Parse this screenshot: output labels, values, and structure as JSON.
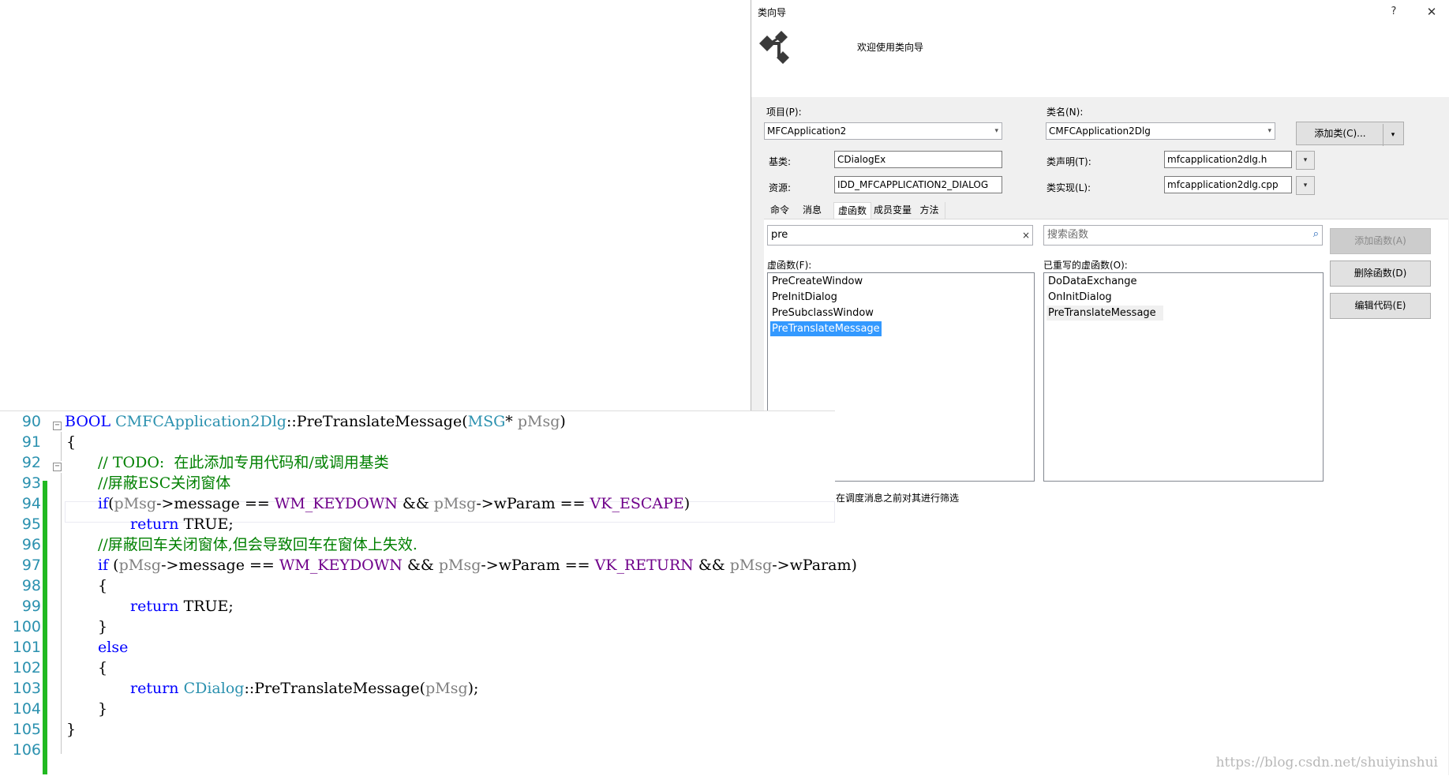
{
  "dialog": {
    "title": "类向导",
    "help": "?",
    "close": "✕",
    "welcome": "欢迎使用类向导",
    "project_label": "项目(P):",
    "project_value": "MFCApplication2",
    "class_label": "类名(N):",
    "class_value": "CMFCApplication2Dlg",
    "add_class_label": "添加类(C)...",
    "add_class_arrow": "▾",
    "base_label": "基类:",
    "base_value": "CDialogEx",
    "resource_label": "资源:",
    "resource_value": "IDD_MFCAPPLICATION2_DIALOG",
    "decl_label": "类声明(T):",
    "decl_value": "mfcapplication2dlg.h",
    "impl_label": "类实现(L):",
    "impl_value": "mfcapplication2dlg.cpp",
    "dropdown_glyph": "▾",
    "tabs": [
      "命令",
      "消息",
      "虚函数",
      "成员变量",
      "方法"
    ],
    "active_tab": "虚函数",
    "filter_value": "pre",
    "filter_clear": "×",
    "search_placeholder": "搜索函数",
    "add_function": "添加函数(A)",
    "delete_function": "删除函数(D)",
    "edit_code": "编辑代码(E)",
    "virtuals_label": "虚函数(F):",
    "virtuals": [
      "PreCreateWindow",
      "PreInitDialog",
      "PreSubclassWindow",
      "PreTranslateMessage"
    ],
    "selected_virtual": "PreTranslateMessage",
    "overridden_label": "已重写的虚函数(O):",
    "overridden": [
      "DoDataExchange",
      "OnInitDialog",
      "PreTranslateMessage"
    ],
    "description": "在调度消息之前对其进行筛选"
  },
  "editor": {
    "line_numbers": [
      "90",
      "91",
      "92",
      "93",
      "94",
      "95",
      "96",
      "97",
      "98",
      "99",
      "100",
      "101",
      "102",
      "103",
      "104",
      "105",
      "106"
    ],
    "lines": {
      "l90": {
        "bool": "BOOL",
        "cls": "CMFCApplication2Dlg",
        "scope": "::",
        "fn": "PreTranslateMessage",
        "open": "(",
        "type": "MSG",
        "star": "* ",
        "param": "pMsg",
        "close": ")"
      },
      "l91": {
        "text": "{"
      },
      "l92": {
        "text": "// TODO:  在此添加专用代码和/或调用基类"
      },
      "l93": {
        "text": "//屏蔽ESC关闭窗体"
      },
      "l94": {
        "kw": "if",
        "p1": "(",
        "v1": "pMsg",
        "a1": "->",
        "m1": "message == ",
        "c1": "WM_KEYDOWN",
        "t1": " && ",
        "v2": "pMsg",
        "a2": "->",
        "m2": "wParam == ",
        "c2": "VK_ESCAPE",
        "p2": ")"
      },
      "l95": {
        "kw": "return",
        "val": " TRUE;"
      },
      "l96": {
        "text": "//屏蔽回车关闭窗体,但会导致回车在窗体上失效."
      },
      "l97": {
        "kw": "if",
        "p1": " (",
        "v1": "pMsg",
        "a1": "->",
        "m1": "message == ",
        "c1": "WM_KEYDOWN",
        "t1": " && ",
        "v2": "pMsg",
        "a2": "->",
        "m2": "wParam == ",
        "c2": "VK_RETURN",
        "t2": " && ",
        "v3": "pMsg",
        "a3": "->",
        "m3": "wParam)"
      },
      "l98": {
        "text": "{"
      },
      "l99": {
        "kw": "return",
        "val": " TRUE;"
      },
      "l100": {
        "text": "}"
      },
      "l101": {
        "kw": "else"
      },
      "l102": {
        "text": "{"
      },
      "l103": {
        "kw": "return",
        "cls": "CDialog",
        "scope": "::",
        "fn": "PreTranslateMessage",
        "open": "(",
        "param": "pMsg",
        "close": ");"
      },
      "l104": {
        "text": "}"
      },
      "l105": {
        "text": "}"
      }
    },
    "collapse_glyph": "−"
  },
  "watermark": "https://blog.csdn.net/shuiyinshui",
  "colors": {
    "selection": "#3399ff",
    "line_number": "#2b91af",
    "keyword": "#0000ff",
    "comment": "#008000",
    "macro": "#6f008a",
    "type": "#2b91af",
    "change_bar": "#21b921"
  },
  "icons": [
    "class-wizard-logo-icon",
    "help-icon",
    "close-icon",
    "dropdown-arrow-icon",
    "clear-icon",
    "search-icon",
    "collapse-icon"
  ]
}
